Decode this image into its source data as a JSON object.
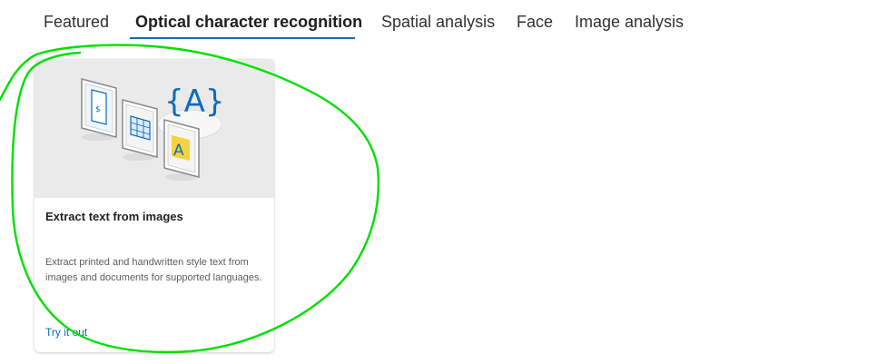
{
  "tabs": [
    {
      "label": "Featured",
      "active": false
    },
    {
      "label": "Optical character recognition",
      "active": true
    },
    {
      "label": "Spatial analysis",
      "active": false
    },
    {
      "label": "Face",
      "active": false
    },
    {
      "label": "Image analysis",
      "active": false
    }
  ],
  "card": {
    "title": "Extract text from images",
    "description": "Extract printed and handwritten style text from images and documents for supported languages.",
    "link_label": "Try it out",
    "illustration": {
      "badge_text": "{A}",
      "tile_letter": "A",
      "icons": [
        "receipt-icon",
        "table-icon",
        "letter-a-icon"
      ]
    }
  },
  "colors": {
    "accent": "#0f6cbd",
    "annotation": "#00e000",
    "tile_yellow": "#f7d23e"
  }
}
